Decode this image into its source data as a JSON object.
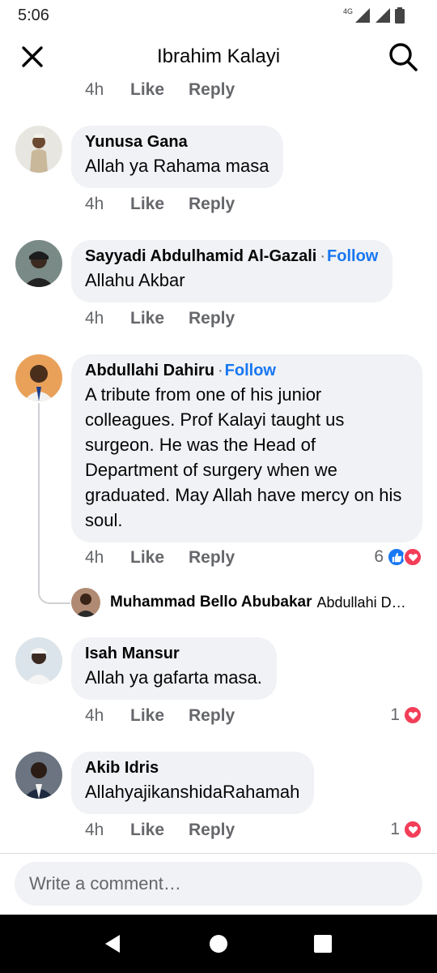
{
  "status_bar": {
    "time": "5:06",
    "network": "4G"
  },
  "header": {
    "title": "Ibrahim Kalayi"
  },
  "top_actions": {
    "time": "4h",
    "like": "Like",
    "reply": "Reply"
  },
  "comments": [
    {
      "name": "Yunusa Gana",
      "follow": "",
      "text": "Allah ya Rahama masa",
      "time": "4h",
      "like": "Like",
      "reply": "Reply",
      "reaction_count": ""
    },
    {
      "name": "Sayyadi Abdulhamid Al-Gazali",
      "follow": "Follow",
      "text": "Allahu Akbar",
      "time": "4h",
      "like": "Like",
      "reply": "Reply",
      "reaction_count": ""
    },
    {
      "name": "Abdullahi Dahiru",
      "follow": "Follow",
      "text": "A tribute from one of his junior colleagues. Prof Kalayi taught us surgeon. He was the Head of Department of surgery when we graduated. May Allah have mercy on his soul.",
      "time": "4h",
      "like": "Like",
      "reply": "Reply",
      "reaction_count": "6"
    },
    {
      "name": "Isah Mansur",
      "follow": "",
      "text": "Allah ya gafarta masa.",
      "time": "4h",
      "like": "Like",
      "reply": "Reply",
      "reaction_count": "1"
    },
    {
      "name": "Akib Idris",
      "follow": "",
      "text": "AllahyajikanshidaRahamah",
      "time": "4h",
      "like": "Like",
      "reply": "Reply",
      "reaction_count": "1"
    }
  ],
  "reply_preview": {
    "name": "Muhammad Bello Abubakar",
    "text": "Abdullahi Dahiru"
  },
  "composer": {
    "placeholder": "Write a comment…"
  },
  "colors": {
    "link": "#1877f2",
    "bubble": "#f0f2f5",
    "muted": "#65676b",
    "love": "#f33e58"
  }
}
